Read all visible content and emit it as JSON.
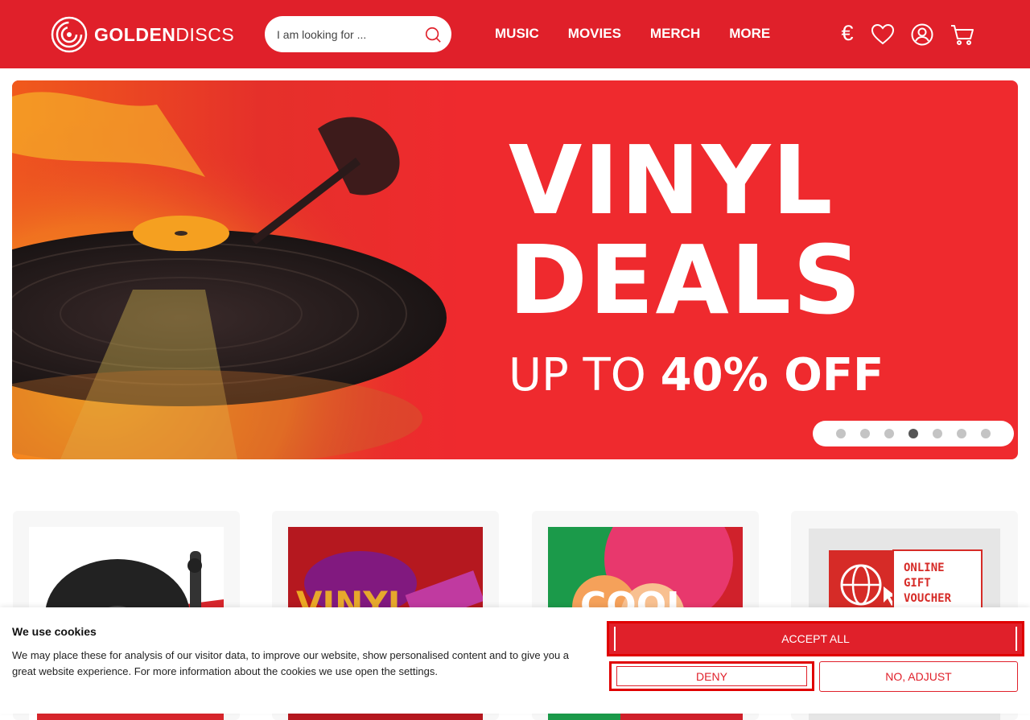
{
  "header": {
    "logo": {
      "bold": "GOLDEN",
      "light": "DISCS"
    },
    "search": {
      "placeholder": "I am looking for ..."
    },
    "nav": [
      "MUSIC",
      "MOVIES",
      "MERCH",
      "MORE"
    ],
    "currency": "€",
    "icons": [
      "heart-icon",
      "account-icon",
      "cart-icon"
    ],
    "brand_color": "#e0202a"
  },
  "hero": {
    "line1": "VINYL",
    "line2": "DEALS",
    "sub_thin": "UP TO",
    "sub_bold": "40% OFF",
    "slides": 7,
    "active_slide": 4
  },
  "cards": [
    {
      "name": "turntable-card"
    },
    {
      "name": "vinyl-promo-card"
    },
    {
      "name": "colourful-promo-card"
    },
    {
      "name": "gift-voucher-card",
      "lines": [
        "ONLINE",
        "GIFT",
        "VOUCHER"
      ]
    }
  ],
  "cookie": {
    "title": "We use cookies",
    "text": "We may place these for analysis of our visitor data, to improve our website, show personalised content and to give you a great website experience. For more information about the cookies we use open the settings.",
    "accept": "ACCEPT ALL",
    "deny": "DENY",
    "adjust": "NO, ADJUST"
  }
}
